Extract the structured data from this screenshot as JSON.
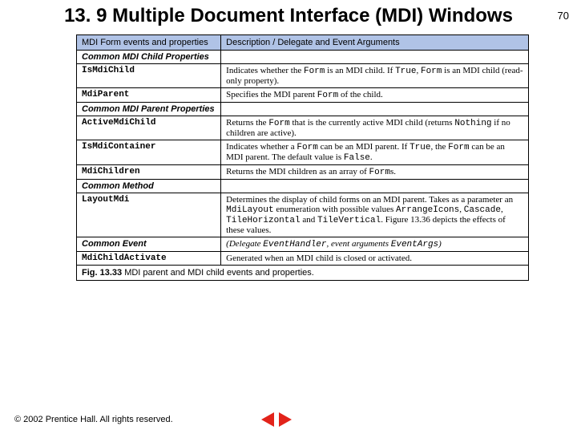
{
  "page_number": "70",
  "title": "13. 9  Multiple Document Interface (MDI) Windows",
  "table": {
    "header": {
      "col1": "MDI Form events and properties",
      "col2": "Description / Delegate and Event Arguments"
    },
    "sections": [
      {
        "type": "section",
        "col1": "Common MDI Child Properties",
        "col2": ""
      },
      {
        "type": "prop",
        "col1": "IsMdiChild",
        "segments": [
          {
            "t": "Indicates whether the "
          },
          {
            "t": "Form",
            "code": true
          },
          {
            "t": " is an MDI child. If "
          },
          {
            "t": "True",
            "code": true
          },
          {
            "t": ", "
          },
          {
            "t": "Form",
            "code": true
          },
          {
            "t": " is an MDI child (read-only property)."
          }
        ]
      },
      {
        "type": "prop",
        "col1": "MdiParent",
        "segments": [
          {
            "t": "Specifies the MDI parent "
          },
          {
            "t": "Form",
            "code": true
          },
          {
            "t": " of the child."
          }
        ]
      },
      {
        "type": "section",
        "col1": "Common MDI Parent Properties",
        "col2": ""
      },
      {
        "type": "prop",
        "col1": "ActiveMdiChild",
        "segments": [
          {
            "t": "Returns the "
          },
          {
            "t": "Form",
            "code": true
          },
          {
            "t": " that is the currently active MDI child (returns "
          },
          {
            "t": "Nothing",
            "code": true
          },
          {
            "t": " if no children are active)."
          }
        ]
      },
      {
        "type": "prop",
        "col1": "IsMdiContainer",
        "segments": [
          {
            "t": "Indicates whether a "
          },
          {
            "t": "Form",
            "code": true
          },
          {
            "t": " can be an MDI parent. If "
          },
          {
            "t": "True",
            "code": true
          },
          {
            "t": ", the "
          },
          {
            "t": "Form",
            "code": true
          },
          {
            "t": " can be an MDI parent. The default value is "
          },
          {
            "t": "False",
            "code": true
          },
          {
            "t": "."
          }
        ]
      },
      {
        "type": "prop",
        "col1": "MdiChildren",
        "segments": [
          {
            "t": "Returns the MDI children as an array of "
          },
          {
            "t": "Form",
            "code": true
          },
          {
            "t": "s."
          }
        ]
      },
      {
        "type": "section",
        "col1": "Common Method",
        "col2": ""
      },
      {
        "type": "prop",
        "col1": "LayoutMdi",
        "segments": [
          {
            "t": "Determines the display of child forms on an MDI parent. Takes as a parameter an "
          },
          {
            "t": "MdiLayout",
            "code": true
          },
          {
            "t": " enumeration with possible values "
          },
          {
            "t": "ArrangeIcons",
            "code": true
          },
          {
            "t": ", "
          },
          {
            "t": "Cascade",
            "code": true
          },
          {
            "t": ", "
          },
          {
            "t": "TileHorizontal",
            "code": true
          },
          {
            "t": " and "
          },
          {
            "t": "TileVertical",
            "code": true
          },
          {
            "t": ". Figure 13.36 depicts the effects of these values."
          }
        ]
      },
      {
        "type": "section",
        "col1": "Common Event",
        "segments": [
          {
            "t": "(Delegate ",
            "i": true
          },
          {
            "t": "EventHandler",
            "code": true,
            "i": true
          },
          {
            "t": ", event arguments ",
            "i": true
          },
          {
            "t": "EventArgs",
            "code": true,
            "i": true
          },
          {
            "t": ")",
            "i": true
          }
        ]
      },
      {
        "type": "prop",
        "col1": "MdiChildActivate",
        "segments": [
          {
            "t": "Generated when an MDI child is closed or activated."
          }
        ]
      }
    ],
    "caption": {
      "figno": "Fig. 13.33",
      "text": "  MDI parent and MDI child events and properties."
    }
  },
  "footer": {
    "copyright": "© 2002 Prentice Hall.  All rights reserved."
  }
}
